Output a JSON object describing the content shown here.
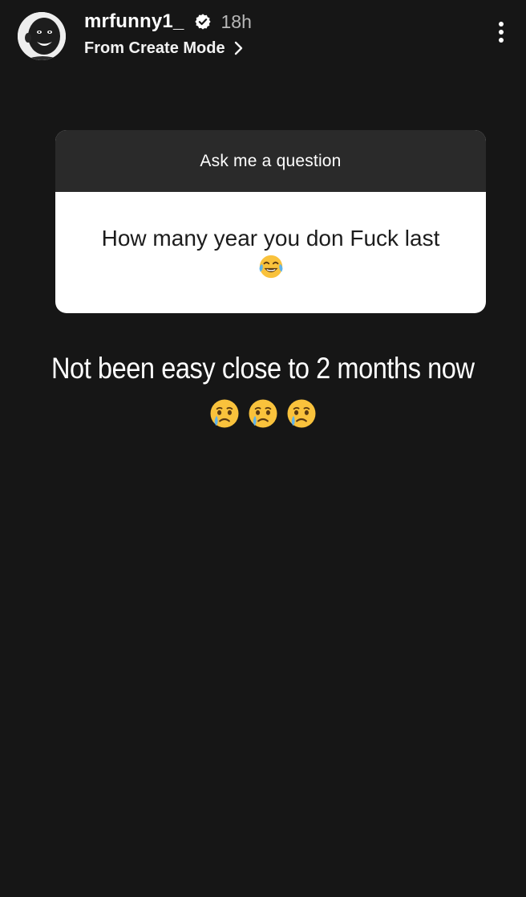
{
  "header": {
    "username": "mrfunny1_",
    "timestamp": "18h",
    "subtitle": "From Create Mode",
    "icons": {
      "avatar": "profile-photo",
      "verified": "verified-badge-icon",
      "chevron": "chevron-right-icon",
      "more": "more-options-icon"
    }
  },
  "sticker": {
    "title": "Ask me a question",
    "question": "How many year you don Fuck last",
    "question_emoji": "face-with-tears-of-joy"
  },
  "reply": {
    "text": "Not been easy close to 2 months now",
    "emojis": [
      "face-holding-back-tears",
      "face-holding-back-tears",
      "face-holding-back-tears"
    ]
  },
  "colors": {
    "background": "#161616",
    "sticker_header": "#2a2a2a",
    "sticker_body": "#ffffff",
    "text_primary": "#ffffff",
    "text_secondary": "#b8b8b8"
  }
}
